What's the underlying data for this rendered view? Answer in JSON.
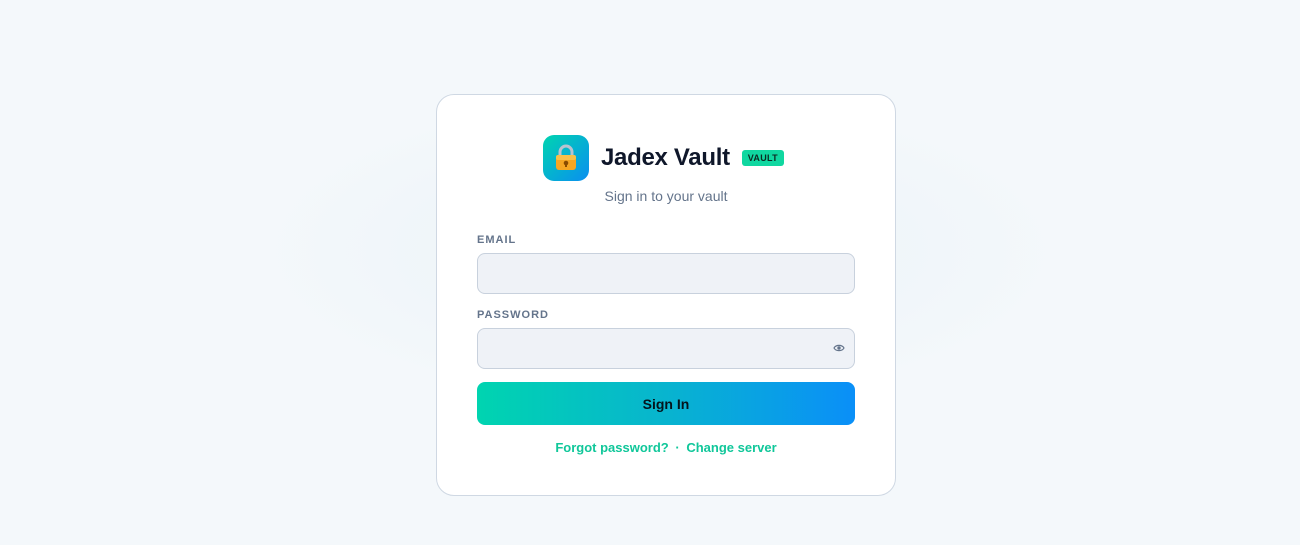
{
  "app": {
    "title": "Jadex Vault",
    "badge": "VAULT",
    "subtitle": "Sign in to your vault",
    "logo_icon": "lock-icon"
  },
  "form": {
    "email_label": "EMAIL",
    "email_value": "",
    "email_placeholder": "",
    "password_label": "PASSWORD",
    "password_value": "",
    "password_placeholder": "",
    "reveal_icon": "eye-icon",
    "submit_label": "Sign In"
  },
  "links": {
    "forgot": "Forgot password?",
    "separator": "·",
    "change_server": "Change server"
  },
  "colors": {
    "accent_start": "#00d4b0",
    "accent_end": "#0a8ff8",
    "link": "#10c79a",
    "badge": "#10d7a0",
    "background": "#f4f8fb"
  }
}
